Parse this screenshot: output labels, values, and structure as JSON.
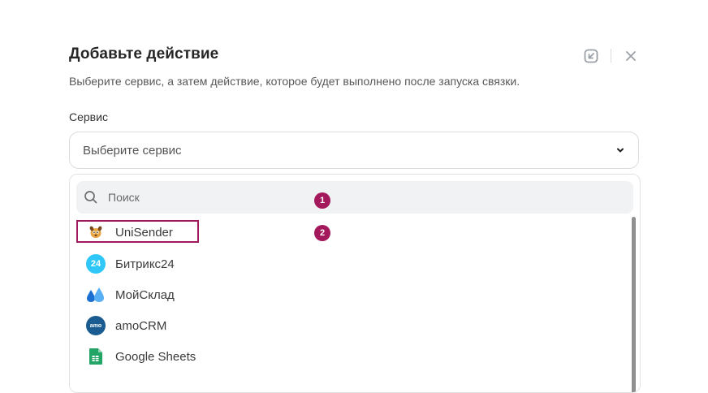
{
  "dialog": {
    "title": "Добавьте действие",
    "subtitle": "Выберите сервис, а затем действие, которое будет выполнено после запуска связки.",
    "header_icons": [
      "collapse-icon",
      "close-icon"
    ]
  },
  "service_field": {
    "label": "Сервис",
    "placeholder": "Выберите сервис",
    "icon": "chevron-down-icon"
  },
  "dropdown": {
    "search_placeholder": "Поиск",
    "items": [
      {
        "label": "UniSender",
        "icon": "unisender-logo",
        "highlighted": true
      },
      {
        "label": "Битрикс24",
        "icon": "bitrix24-logo",
        "logo_text": "24",
        "color": "#2fc7f7"
      },
      {
        "label": "МойСклад",
        "icon": "moysklad-logo",
        "color": "#1a6fd1"
      },
      {
        "label": "amoCRM",
        "icon": "amocrm-logo",
        "logo_text": "amo",
        "color": "#1a5c91"
      },
      {
        "label": "Google Sheets",
        "icon": "google-sheets-logo",
        "color": "#23a566"
      }
    ]
  },
  "annotations": [
    {
      "label": "1"
    },
    {
      "label": "2"
    }
  ],
  "colors": {
    "accent": "#a3195b"
  }
}
